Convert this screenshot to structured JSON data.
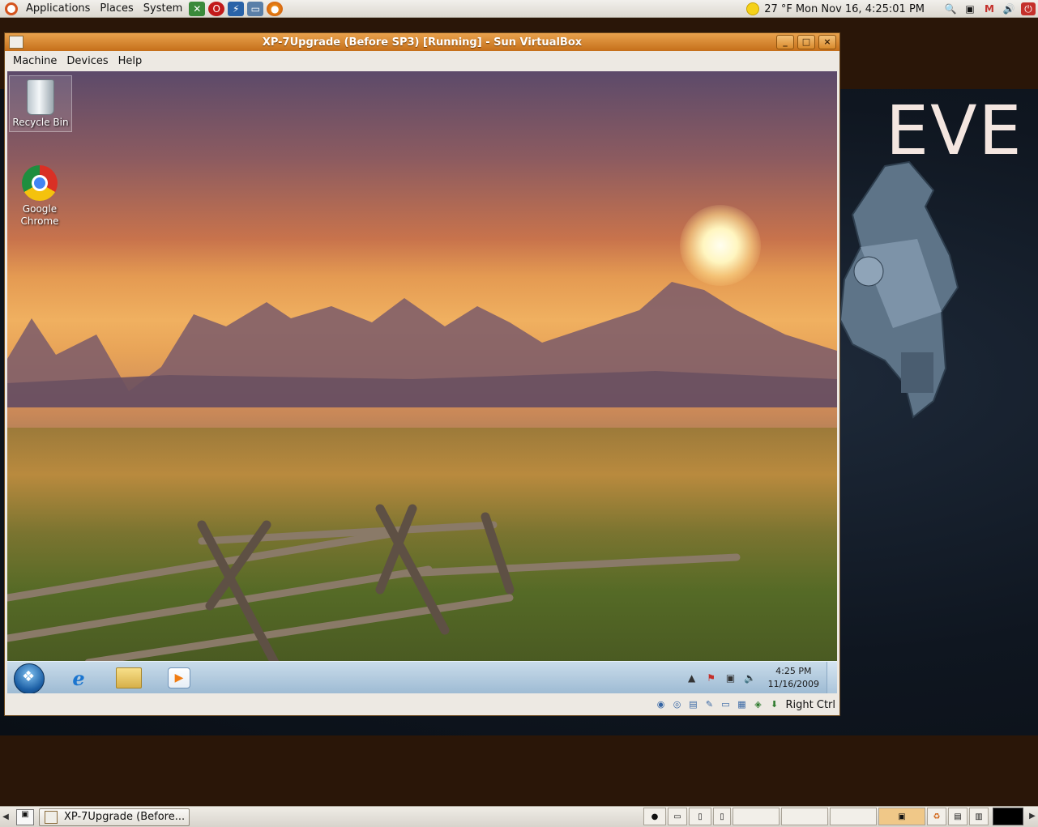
{
  "top_panel": {
    "menus": [
      "Applications",
      "Places",
      "System"
    ],
    "launchers": [
      "network-tool-icon",
      "opera-icon",
      "gparted-icon",
      "remote-desktop-icon",
      "firefox-icon"
    ],
    "weather": "27 °F",
    "clock": "Mon Nov 16,  4:25:01 PM"
  },
  "wallpaper": {
    "text": "EVE"
  },
  "vbox": {
    "title": "XP-7Upgrade (Before SP3) [Running] - Sun VirtualBox",
    "menus": [
      "Machine",
      "Devices",
      "Help"
    ],
    "host_key": "Right Ctrl"
  },
  "guest": {
    "icons": [
      {
        "label": "Recycle Bin"
      },
      {
        "label": "Google\nChrome"
      }
    ],
    "clock_time": "4:25 PM",
    "clock_date": "11/16/2009"
  },
  "bottom_panel": {
    "task": "XP-7Upgrade (Before..."
  }
}
